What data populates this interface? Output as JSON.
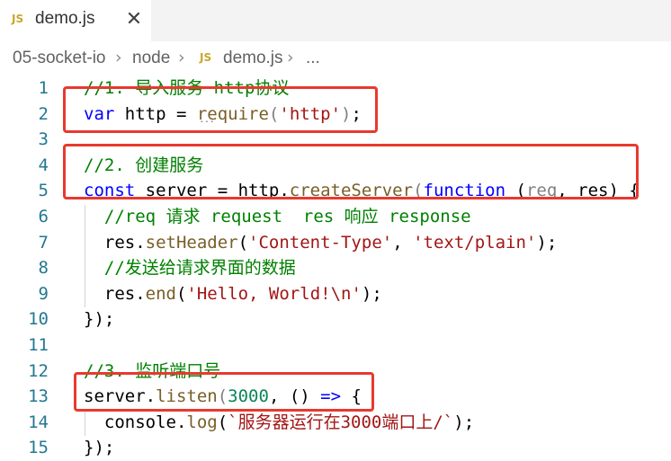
{
  "tab": {
    "icon": "JS",
    "title": "demo.js",
    "close": "✕"
  },
  "breadcrumb": {
    "segments": [
      "05-socket-io",
      "node",
      "demo.js",
      "..."
    ],
    "file_icon": "JS",
    "separator": "›"
  },
  "editor": {
    "line_numbers": [
      "1",
      "2",
      "3",
      "4",
      "5",
      "6",
      "7",
      "8",
      "9",
      "10",
      "11",
      "12",
      "13",
      "14",
      "15"
    ],
    "lines": [
      [
        {
          "t": "//1. 导入服务 http协议",
          "c": "comment"
        }
      ],
      [
        {
          "t": "var",
          "c": "kw"
        },
        {
          "t": " http = "
        },
        {
          "t": "require",
          "c": "fn"
        },
        {
          "t": "(",
          "c": "par"
        },
        {
          "t": "'http'",
          "c": "str"
        },
        {
          "t": ")",
          "c": "par"
        },
        {
          "t": ";"
        }
      ],
      [],
      [
        {
          "t": "//2. 创建服务",
          "c": "comment"
        }
      ],
      [
        {
          "t": "const",
          "c": "kw"
        },
        {
          "t": " server = http."
        },
        {
          "t": "createServer",
          "c": "fn"
        },
        {
          "t": "(",
          "c": "par"
        },
        {
          "t": "function",
          "c": "kw"
        },
        {
          "t": " ("
        },
        {
          "t": "req",
          "c": "par"
        },
        {
          "t": ", res) {"
        }
      ],
      [
        {
          "t": "  //req 请求 request  res 响应 response",
          "c": "comment"
        }
      ],
      [
        {
          "t": "  res."
        },
        {
          "t": "setHeader",
          "c": "fn"
        },
        {
          "t": "("
        },
        {
          "t": "'Content-Type'",
          "c": "str"
        },
        {
          "t": ", "
        },
        {
          "t": "'text/plain'",
          "c": "str"
        },
        {
          "t": ");"
        }
      ],
      [
        {
          "t": "  //发送给请求界面的数据",
          "c": "comment"
        }
      ],
      [
        {
          "t": "  res."
        },
        {
          "t": "end",
          "c": "fn"
        },
        {
          "t": "("
        },
        {
          "t": "'Hello, World!\\n'",
          "c": "str"
        },
        {
          "t": ");"
        }
      ],
      [
        {
          "t": "});"
        }
      ],
      [],
      [
        {
          "t": "//3. 监听端口号",
          "c": "comment"
        }
      ],
      [
        {
          "t": "server."
        },
        {
          "t": "listen",
          "c": "fn"
        },
        {
          "t": "(",
          "c": "par"
        },
        {
          "t": "3000",
          "c": "num"
        },
        {
          "t": ", () "
        },
        {
          "t": "=>",
          "c": "kw"
        },
        {
          "t": " {"
        }
      ],
      [
        {
          "t": "  console."
        },
        {
          "t": "log",
          "c": "fn"
        },
        {
          "t": "("
        },
        {
          "t": "`服务器运行在3000端口上/`",
          "c": "str"
        },
        {
          "t": ");"
        }
      ],
      [
        {
          "t": "});"
        }
      ]
    ]
  },
  "colors": {
    "comment": "#008000",
    "keyword": "#0000ff",
    "string": "#a31515",
    "number": "#098658",
    "function": "#795e26",
    "line_number": "#237893",
    "highlight_box": "#e8392f"
  }
}
